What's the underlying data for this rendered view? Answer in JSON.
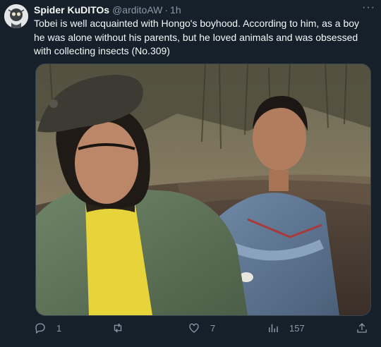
{
  "author": {
    "name": "Spider KuDITOs",
    "handle": "@arditoAW",
    "separator": "·",
    "time": "1h"
  },
  "more_label": "···",
  "tweet_text": "Tobei is well acquainted with Hongo's boyhood. According to him, as a boy he was alone without his parents, but he loved animals and was obsessed with collecting insects (No.309)",
  "actions": {
    "reply_count": "1",
    "retweet_count": "",
    "like_count": "7",
    "views_count": "157"
  },
  "icons": {
    "reply": "reply-icon",
    "retweet": "retweet-icon",
    "like": "heart-icon",
    "views": "views-icon",
    "share": "share-icon"
  },
  "colors": {
    "background": "#15202b",
    "text": "#f7f9f9",
    "muted": "#8b98a5",
    "border": "#38444d"
  }
}
